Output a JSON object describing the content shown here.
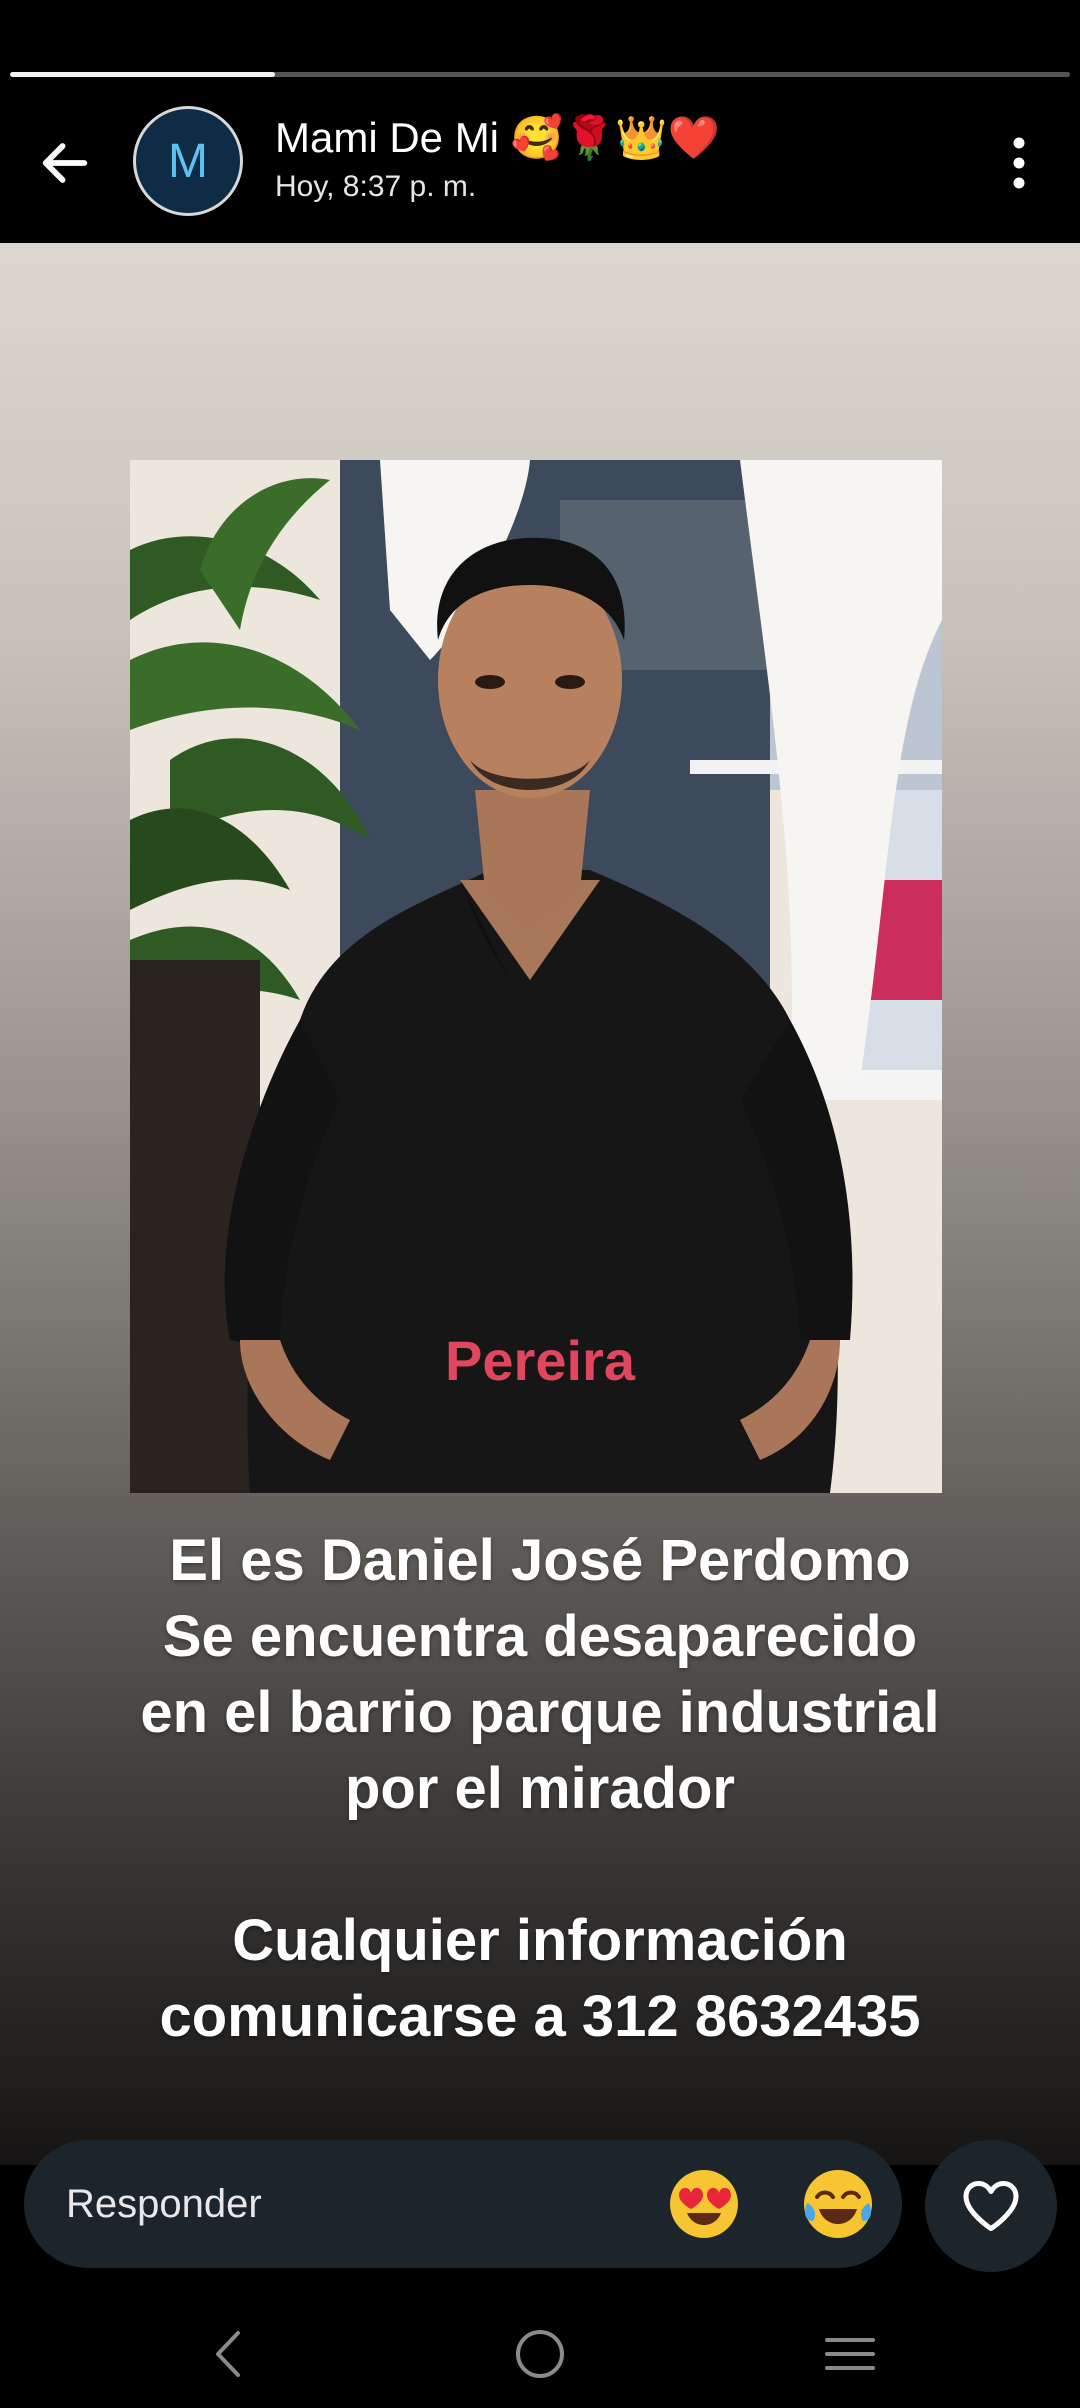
{
  "story": {
    "progress": 0.25,
    "sender": {
      "name": "Mami De Mi 🥰🌹👑❤️",
      "avatar_initial": "M",
      "timestamp": "Hoy, 8:37 p. m."
    },
    "photo": {
      "overlay_text": "Pereira"
    },
    "caption": {
      "line1": "El es Daniel José Perdomo",
      "line2": "Se encuentra desaparecido",
      "line3": "en el barrio parque industrial",
      "line4": "por el mirador",
      "line5": "Cualquier información",
      "line6": "comunicarse a 312 8632435"
    }
  },
  "reply_bar": {
    "placeholder": "Responder",
    "quick_reactions": [
      "😍",
      "😂"
    ]
  },
  "icons": {
    "back": "arrow-left-icon",
    "menu": "more-vertical-icon",
    "like": "heart-outline-icon",
    "nav_back": "chevron-left-icon",
    "nav_home": "circle-home-icon",
    "nav_recents": "recents-lines-icon"
  },
  "colors": {
    "avatar_bg": "#0e2c45",
    "avatar_text": "#5ec1f0",
    "reply_bg": "#1c252c",
    "overlay_text": "#e0475e"
  }
}
